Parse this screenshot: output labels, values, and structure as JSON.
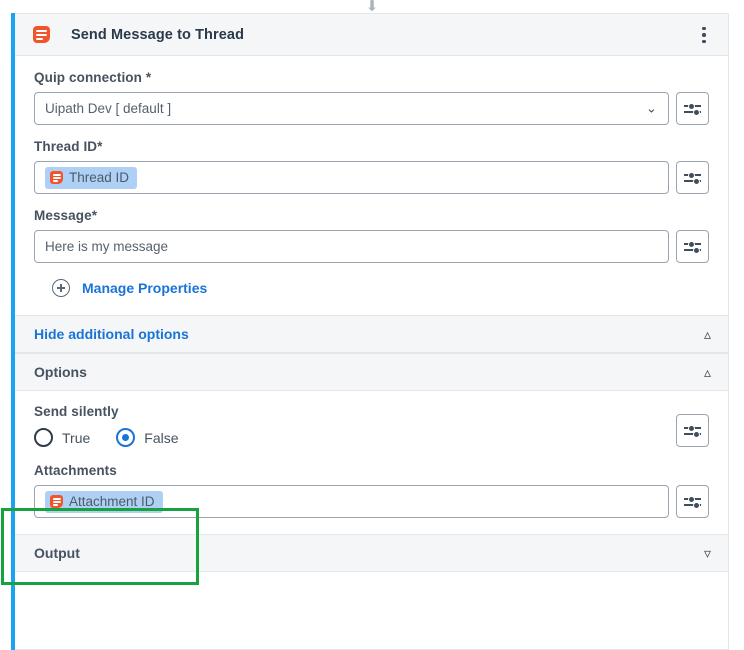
{
  "top": {
    "drop_arrow_icon": "arrow-down-icon"
  },
  "header": {
    "title": "Send Message to Thread",
    "app_icon": "quip-icon",
    "menu_icon": "kebab-menu-icon"
  },
  "fields": {
    "connection": {
      "label": "Quip connection *",
      "value": "Uipath Dev [ default ]",
      "dropdown_icon": "chevron-down-icon",
      "config_icon": "sliders-icon"
    },
    "thread_id": {
      "label": "Thread ID*",
      "chip_text": "Thread ID",
      "chip_icon": "quip-icon",
      "config_icon": "sliders-icon"
    },
    "message": {
      "label": "Message*",
      "value": "Here is my message",
      "config_icon": "sliders-icon"
    }
  },
  "manage_properties": {
    "label": "Manage Properties",
    "icon": "plus-circle-icon"
  },
  "sections": {
    "additional_options": {
      "label": "Hide additional options",
      "chevron_icon": "chevron-up-icon"
    },
    "options": {
      "label": "Options",
      "chevron_icon": "chevron-up-icon"
    },
    "output": {
      "label": "Output",
      "chevron_icon": "chevron-down-icon"
    }
  },
  "options": {
    "send_silently": {
      "label": "Send silently",
      "choices": [
        {
          "label": "True",
          "selected": false
        },
        {
          "label": "False",
          "selected": true
        }
      ],
      "config_icon": "sliders-icon"
    },
    "attachments": {
      "label": "Attachments",
      "chip_text": "Attachment ID",
      "chip_icon": "quip-icon",
      "config_icon": "sliders-icon",
      "highlighted": true
    }
  },
  "colors": {
    "accent_blue": "#1aa3f0",
    "link_blue": "#1874d6",
    "quip_red": "#f2552c",
    "chip_blue": "#aed0f5",
    "highlight_green": "#18a23f",
    "section_bg": "#f4f6f8"
  }
}
